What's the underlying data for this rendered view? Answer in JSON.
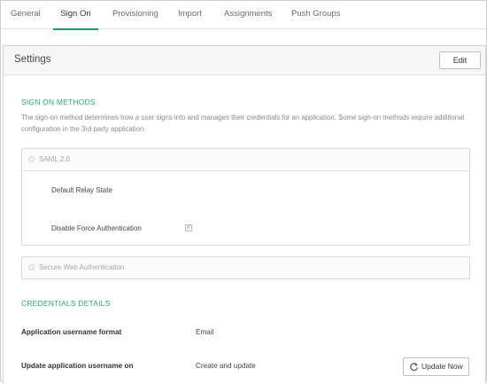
{
  "tabs": [
    {
      "label": "General"
    },
    {
      "label": "Sign On"
    },
    {
      "label": "Provisioning"
    },
    {
      "label": "Import"
    },
    {
      "label": "Assignments"
    },
    {
      "label": "Push Groups"
    }
  ],
  "active_tab": "Sign On",
  "settings": {
    "title": "Settings",
    "edit_label": "Edit"
  },
  "sign_on_methods": {
    "title": "SIGN ON METHODS",
    "description": "The sign-on method determines how a user signs into and manages their credentials for an application. Some sign-on methods require additional configuration in the 3rd party application.",
    "saml": {
      "label": "SAML 2.0",
      "default_relay_state_label": "Default Relay State",
      "disable_force_auth_label": "Disable Force Authentication",
      "disable_force_auth_checked": true
    },
    "swa": {
      "label": "Secure Web Authentication"
    }
  },
  "credentials": {
    "title": "CREDENTIALS DETAILS",
    "username_format_label": "Application username format",
    "username_format_value": "Email",
    "update_on_label": "Update application username on",
    "update_on_value": "Create and update",
    "update_now_label": "Update Now"
  },
  "colors": {
    "accent": "#1a9e6a",
    "section_title": "#2aa577"
  },
  "icons": {
    "checkmark": "check-icon",
    "refresh": "refresh-icon"
  }
}
